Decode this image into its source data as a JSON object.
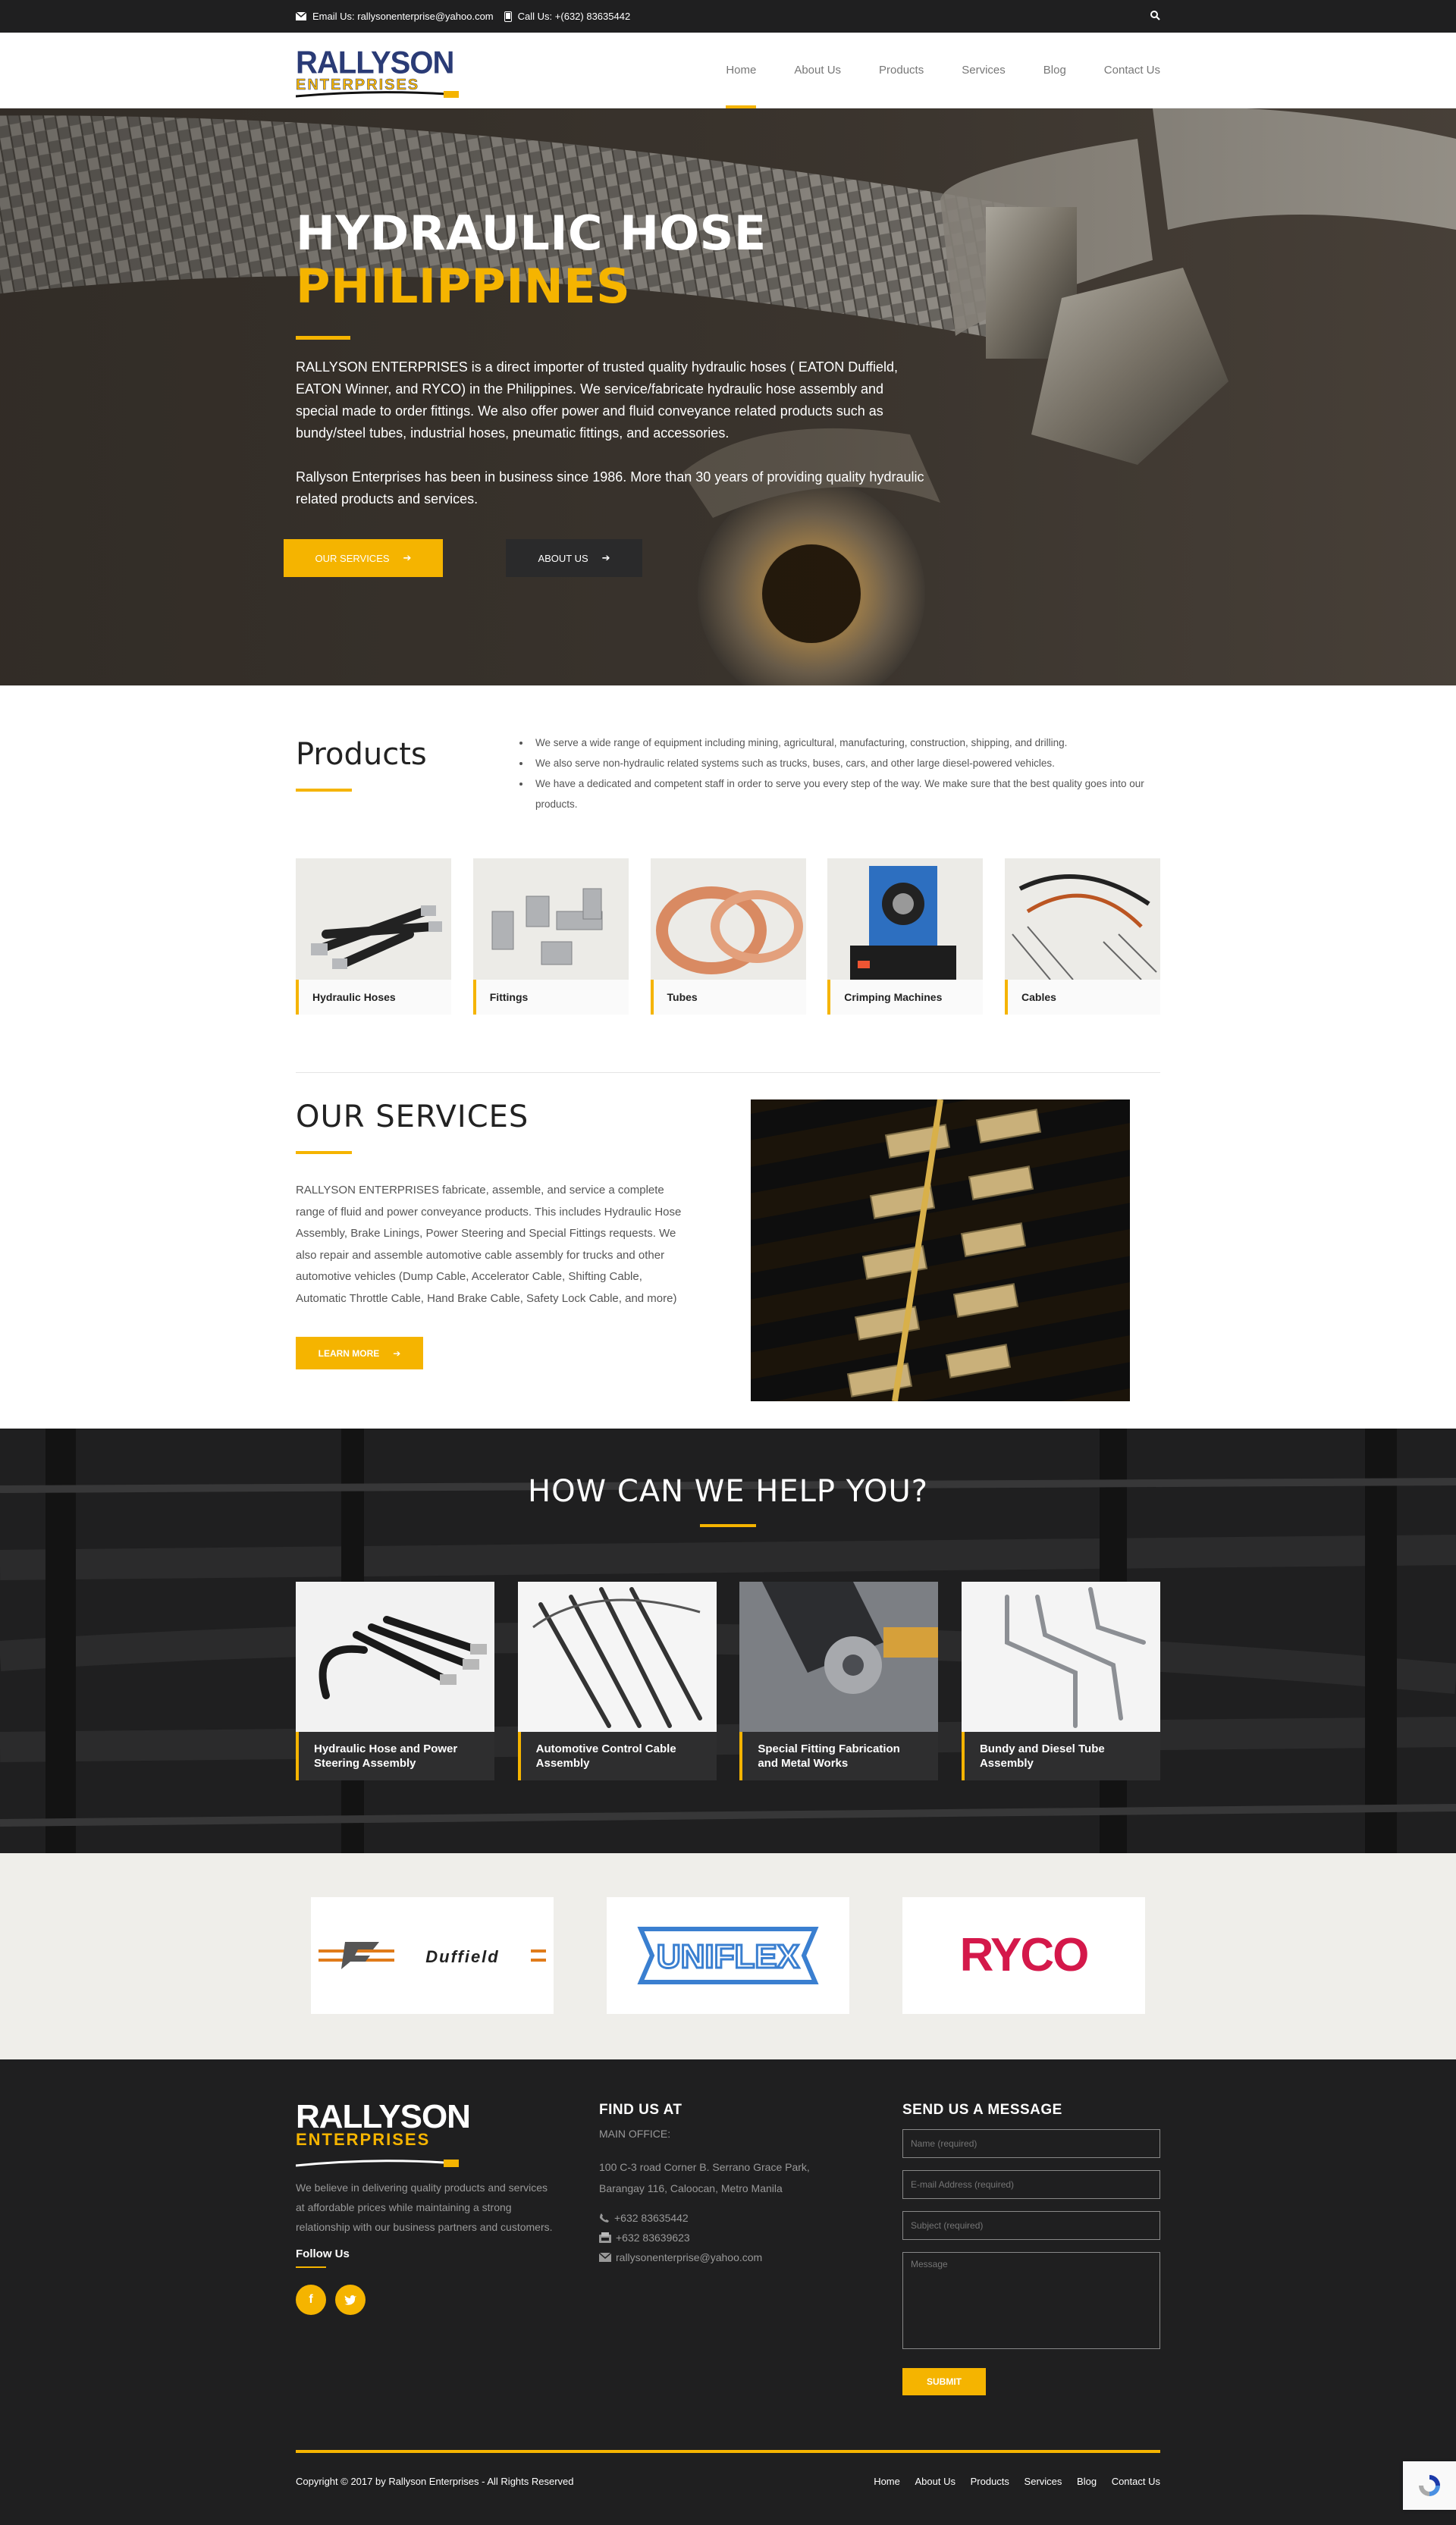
{
  "topbar": {
    "email_label": "Email Us:",
    "email": "rallysonenterprise@yahoo.com",
    "phone_label": "Call Us:",
    "phone": "+(632) 83635442"
  },
  "brand": {
    "line1": "RALLYSON",
    "line2": "ENTERPRISES"
  },
  "nav": [
    {
      "label": "Home",
      "active": true
    },
    {
      "label": "About Us"
    },
    {
      "label": "Products"
    },
    {
      "label": "Services"
    },
    {
      "label": "Blog"
    },
    {
      "label": "Contact Us"
    }
  ],
  "hero": {
    "title_line1": "HYDRAULIC HOSE",
    "title_line2": "PHILIPPINES",
    "para1": "RALLYSON ENTERPRISES is a direct importer of trusted quality hydraulic hoses ( EATON Duffield, EATON Winner, and RYCO) in the Philippines. We service/fabricate hydraulic hose assembly and special made to order fittings. We also offer power and fluid conveyance related products such as bundy/steel tubes, industrial hoses, pneumatic fittings, and accessories.",
    "para2": "Rallyson Enterprises has been in business since 1986. More than 30 years of providing quality hydraulic related products and services.",
    "btn_services": "OUR SERVICES",
    "btn_about": "ABOUT US"
  },
  "products": {
    "title": "Products",
    "bullets": [
      "We serve a wide range of equipment including mining, agricultural, manufacturing, construction, shipping, and drilling.",
      "We also serve non-hydraulic related systems such as trucks, buses, cars, and other large diesel-powered vehicles.",
      "We have a dedicated and competent staff in order to serve you every step of the way. We make sure that the best quality goes into our products."
    ],
    "cards": [
      {
        "label": "Hydraulic Hoses"
      },
      {
        "label": "Fittings"
      },
      {
        "label": "Tubes"
      },
      {
        "label": "Crimping Machines"
      },
      {
        "label": "Cables"
      }
    ]
  },
  "services": {
    "title": "OUR SERVICES",
    "text": "RALLYSON ENTERPRISES fabricate, assemble, and service a complete range of fluid and power conveyance products. This includes Hydraulic Hose Assembly, Brake Linings, Power Steering and Special Fittings requests. We also repair and assemble automotive cable assembly for trucks and other automotive vehicles  (Dump Cable, Accelerator Cable, Shifting Cable, Automatic Throttle Cable, Hand Brake Cable, Safety Lock Cable, and more)",
    "button": "LEARN MORE"
  },
  "help": {
    "title": "HOW CAN WE HELP YOU?",
    "cards": [
      {
        "label": "Hydraulic Hose and Power Steering Assembly"
      },
      {
        "label": "Automotive Control Cable Assembly"
      },
      {
        "label": "Special Fitting Fabrication and Metal Works"
      },
      {
        "label": "Bundy and Diesel Tube Assembly"
      }
    ]
  },
  "brands": [
    {
      "name": "Duffield",
      "color": "#e07b1a"
    },
    {
      "name": "UNIFLEX",
      "color": "#3a7fd0"
    },
    {
      "name": "RYCO",
      "color": "#d4184a"
    }
  ],
  "footer": {
    "desc": "We believe in delivering quality products and services at affordable prices while maintaining a strong relationship with our business partners and customers.",
    "follow": "Follow Us",
    "find_title": "FIND US AT",
    "office_label": "MAIN OFFICE:",
    "address": "100 C-3 road Corner B. Serrano Grace Park, Barangay 116, Caloocan, Metro Manila",
    "phone1": "+632 83635442",
    "phone2": "+632 83639623",
    "email": "rallysonenterprise@yahoo.com",
    "msg_title": "SEND US A MESSAGE",
    "ph_name": "Name (required)",
    "ph_email": "E-mail Address (required)",
    "ph_subject": "Subject (required)",
    "ph_message": "Message",
    "submit": "SUBMIT",
    "copyright": "Copyright © 2017 by Rallyson Enterprises - All Rights Reserved",
    "links": [
      "Home",
      "About Us",
      "Products",
      "Services",
      "Blog",
      "Contact Us"
    ]
  },
  "colors": {
    "accent": "#f5b400",
    "dark": "#1f1f20",
    "brand_blue": "#2a3b76"
  }
}
